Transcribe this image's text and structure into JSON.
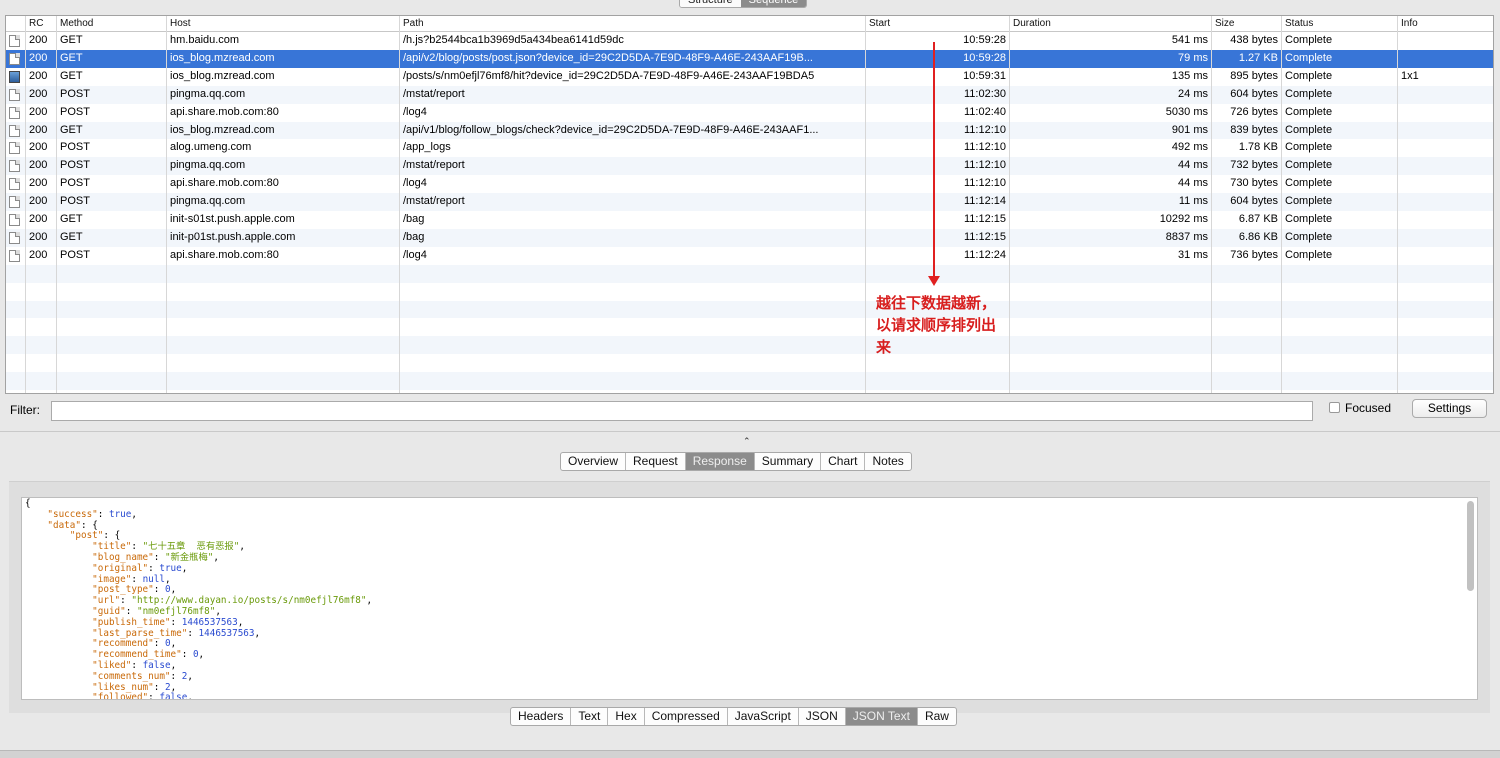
{
  "top_tabs": [
    {
      "label": "Structure",
      "selected": false
    },
    {
      "label": "Sequence",
      "selected": true
    }
  ],
  "columns": [
    "RC",
    "Method",
    "Host",
    "Path",
    "Start",
    "Duration",
    "Size",
    "Status",
    "Info"
  ],
  "rows": [
    {
      "icon": "text-file-icon",
      "rc": "200",
      "method": "GET",
      "host": "hm.baidu.com",
      "path": "/h.js?b2544bca1b3969d5a434bea6141d59dc",
      "start": "10:59:28",
      "duration": "541 ms",
      "size": "438 bytes",
      "status": "Complete",
      "info": ""
    },
    {
      "icon": "html-file-icon",
      "rc": "200",
      "method": "GET",
      "host": "ios_blog.mzread.com",
      "path": "/api/v2/blog/posts/post.json?device_id=29C2D5DA-7E9D-48F9-A46E-243AAF19B...",
      "start": "10:59:28",
      "duration": "79 ms",
      "size": "1.27 KB",
      "status": "Complete",
      "info": "",
      "selected": true
    },
    {
      "icon": "image-file-icon",
      "rc": "200",
      "method": "GET",
      "host": "ios_blog.mzread.com",
      "path": "/posts/s/nm0efjl76mf8/hit?device_id=29C2D5DA-7E9D-48F9-A46E-243AAF19BDA5",
      "start": "10:59:31",
      "duration": "135 ms",
      "size": "895 bytes",
      "status": "Complete",
      "info": "1x1"
    },
    {
      "icon": "file-icon",
      "rc": "200",
      "method": "POST",
      "host": "pingma.qq.com",
      "path": "/mstat/report",
      "start": "11:02:30",
      "duration": "24 ms",
      "size": "604 bytes",
      "status": "Complete",
      "info": ""
    },
    {
      "icon": "file-icon",
      "rc": "200",
      "method": "POST",
      "host": "api.share.mob.com:80",
      "path": "/log4",
      "start": "11:02:40",
      "duration": "5030 ms",
      "size": "726 bytes",
      "status": "Complete",
      "info": ""
    },
    {
      "icon": "html-file-icon",
      "rc": "200",
      "method": "GET",
      "host": "ios_blog.mzread.com",
      "path": "/api/v1/blog/follow_blogs/check?device_id=29C2D5DA-7E9D-48F9-A46E-243AAF1...",
      "start": "11:12:10",
      "duration": "901 ms",
      "size": "839 bytes",
      "status": "Complete",
      "info": ""
    },
    {
      "icon": "file-icon",
      "rc": "200",
      "method": "POST",
      "host": "alog.umeng.com",
      "path": "/app_logs",
      "start": "11:12:10",
      "duration": "492 ms",
      "size": "1.78 KB",
      "status": "Complete",
      "info": ""
    },
    {
      "icon": "file-icon",
      "rc": "200",
      "method": "POST",
      "host": "pingma.qq.com",
      "path": "/mstat/report",
      "start": "11:12:10",
      "duration": "44 ms",
      "size": "732 bytes",
      "status": "Complete",
      "info": ""
    },
    {
      "icon": "file-icon",
      "rc": "200",
      "method": "POST",
      "host": "api.share.mob.com:80",
      "path": "/log4",
      "start": "11:12:10",
      "duration": "44 ms",
      "size": "730 bytes",
      "status": "Complete",
      "info": ""
    },
    {
      "icon": "file-icon",
      "rc": "200",
      "method": "POST",
      "host": "pingma.qq.com",
      "path": "/mstat/report",
      "start": "11:12:14",
      "duration": "11 ms",
      "size": "604 bytes",
      "status": "Complete",
      "info": ""
    },
    {
      "icon": "file-icon",
      "rc": "200",
      "method": "GET",
      "host": "init-s01st.push.apple.com",
      "path": "/bag",
      "start": "11:12:15",
      "duration": "10292 ms",
      "size": "6.87 KB",
      "status": "Complete",
      "info": ""
    },
    {
      "icon": "file-icon",
      "rc": "200",
      "method": "GET",
      "host": "init-p01st.push.apple.com",
      "path": "/bag",
      "start": "11:12:15",
      "duration": "8837 ms",
      "size": "6.86 KB",
      "status": "Complete",
      "info": ""
    },
    {
      "icon": "file-icon",
      "rc": "200",
      "method": "POST",
      "host": "api.share.mob.com:80",
      "path": "/log4",
      "start": "11:12:24",
      "duration": "31 ms",
      "size": "736 bytes",
      "status": "Complete",
      "info": ""
    }
  ],
  "annotation": "越往下数据越新，以请求顺序排列出来",
  "filter": {
    "label": "Filter:",
    "value": ""
  },
  "focused": {
    "label": "Focused",
    "checked": false
  },
  "settings_label": "Settings",
  "grip": "⌃",
  "detail_tabs": [
    {
      "label": "Overview"
    },
    {
      "label": "Request"
    },
    {
      "label": "Response",
      "selected": true
    },
    {
      "label": "Summary"
    },
    {
      "label": "Chart"
    },
    {
      "label": "Notes"
    }
  ],
  "body_tabs": [
    {
      "label": "Headers"
    },
    {
      "label": "Text"
    },
    {
      "label": "Hex"
    },
    {
      "label": "Compressed"
    },
    {
      "label": "JavaScript"
    },
    {
      "label": "JSON"
    },
    {
      "label": "JSON Text",
      "selected": true
    },
    {
      "label": "Raw"
    }
  ],
  "response_lines": [
    {
      "indent": 0,
      "text": "{"
    },
    {
      "indent": 1,
      "key": "\"success\"",
      "val": "true",
      "type": "v",
      "trail": ","
    },
    {
      "indent": 1,
      "key": "\"data\"",
      "val": "{",
      "type": "p"
    },
    {
      "indent": 2,
      "key": "\"post\"",
      "val": "{",
      "type": "p"
    },
    {
      "indent": 3,
      "key": "\"title\"",
      "val": "\"七十五章  恶有恶报\"",
      "type": "s",
      "trail": ","
    },
    {
      "indent": 3,
      "key": "\"blog_name\"",
      "val": "\"新金瓶梅\"",
      "type": "s",
      "trail": ","
    },
    {
      "indent": 3,
      "key": "\"original\"",
      "val": "true",
      "type": "v",
      "trail": ","
    },
    {
      "indent": 3,
      "key": "\"image\"",
      "val": "null",
      "type": "v",
      "trail": ","
    },
    {
      "indent": 3,
      "key": "\"post_type\"",
      "val": "0",
      "type": "n",
      "trail": ","
    },
    {
      "indent": 3,
      "key": "\"url\"",
      "val": "\"http://www.dayan.io/posts/s/nm0efjl76mf8\"",
      "type": "s",
      "trail": ","
    },
    {
      "indent": 3,
      "key": "\"guid\"",
      "val": "\"nm0efjl76mf8\"",
      "type": "s",
      "trail": ","
    },
    {
      "indent": 3,
      "key": "\"publish_time\"",
      "val": "1446537563",
      "type": "n",
      "trail": ","
    },
    {
      "indent": 3,
      "key": "\"last_parse_time\"",
      "val": "1446537563",
      "type": "n",
      "trail": ","
    },
    {
      "indent": 3,
      "key": "\"recommend\"",
      "val": "0",
      "type": "n",
      "trail": ","
    },
    {
      "indent": 3,
      "key": "\"recommend_time\"",
      "val": "0",
      "type": "n",
      "trail": ","
    },
    {
      "indent": 3,
      "key": "\"liked\"",
      "val": "false",
      "type": "v",
      "trail": ","
    },
    {
      "indent": 3,
      "key": "\"comments_num\"",
      "val": "2",
      "type": "n",
      "trail": ","
    },
    {
      "indent": 3,
      "key": "\"likes_num\"",
      "val": "2",
      "type": "n",
      "trail": ","
    },
    {
      "indent": 3,
      "key": "\"followed\"",
      "val": "false",
      "type": "v",
      "trail": ","
    }
  ]
}
